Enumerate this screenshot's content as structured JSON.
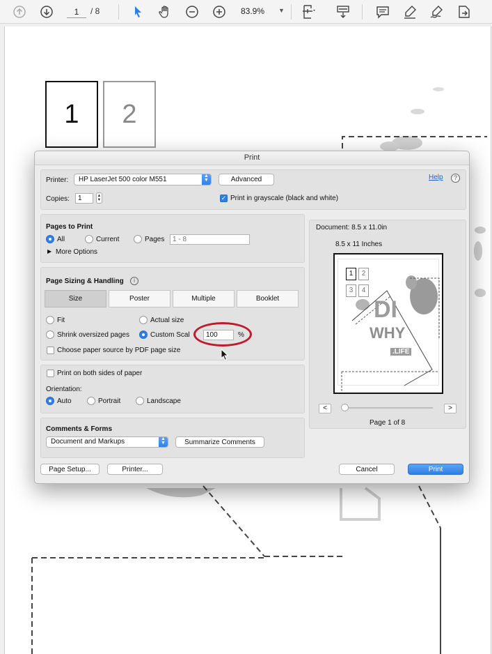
{
  "toolbar": {
    "current_page": "1",
    "page_total": "/ 8",
    "zoom": "83.9%"
  },
  "background_pages": {
    "page1": "1",
    "page2": "2"
  },
  "dialog": {
    "title": "Print",
    "printer_label": "Printer:",
    "printer_value": "HP LaserJet 500 color M551",
    "advanced_button": "Advanced",
    "help_link": "Help",
    "help_icon": "?",
    "copies_label": "Copies:",
    "copies_value": "1",
    "grayscale_label": "Print in grayscale (black and white)",
    "grayscale_checked": true,
    "pages_to_print": {
      "heading": "Pages to Print",
      "all": "All",
      "current": "Current",
      "pages": "Pages",
      "pages_placeholder": "1 - 8",
      "more_options": "More Options",
      "selected": "all"
    },
    "page_sizing": {
      "heading": "Page Sizing & Handling",
      "info_icon": "i",
      "tabs": [
        "Size",
        "Poster",
        "Multiple",
        "Booklet"
      ],
      "active_tab": "Size",
      "fit": "Fit",
      "actual_size": "Actual size",
      "shrink": "Shrink oversized pages",
      "custom_scale": "Custom Scal",
      "custom_scale_value": "100",
      "percent": "%",
      "choose_source": "Choose paper source by PDF page size",
      "selected": "custom_scale"
    },
    "duplex_label": "Print on both sides of paper",
    "orientation": {
      "heading": "Orientation:",
      "auto": "Auto",
      "portrait": "Portrait",
      "landscape": "Landscape",
      "selected": "auto"
    },
    "comments_forms": {
      "heading": "Comments & Forms",
      "select_value": "Document and Markups",
      "summarize_button": "Summarize Comments"
    },
    "preview": {
      "document_size": "Document: 8.5 x 11.0in",
      "paper_size": "8.5 x 11 Inches",
      "prev_button": "<",
      "next_button": ">",
      "page_label": "Page 1 of 8",
      "thumb_boxes": [
        "1",
        "2",
        "3",
        "4"
      ],
      "art_text_1": "DI",
      "art_text_2": "WHY",
      "art_text_3": ".LIFE"
    },
    "buttons": {
      "page_setup": "Page Setup...",
      "printer": "Printer...",
      "cancel": "Cancel",
      "print": "Print"
    }
  },
  "colors": {
    "accent": "#2f7ee6",
    "highlight": "#c11a2b",
    "link": "#2463c9"
  }
}
